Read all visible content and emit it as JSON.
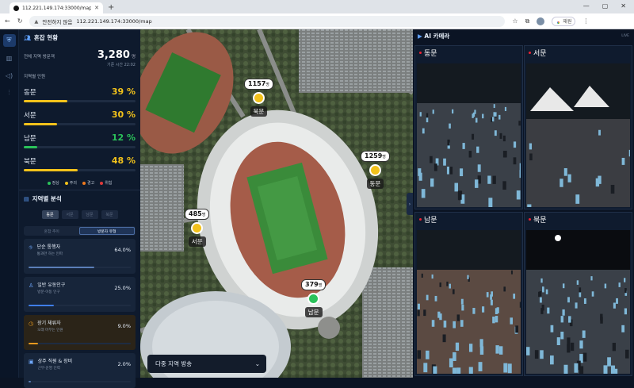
{
  "browser": {
    "tab_title": "112.221.149.174:33000/map",
    "security_label": "안전하지 않음",
    "url": "112.221.149.174:33000/map",
    "relaunch_label": "재원"
  },
  "rail": {
    "items": [
      "shield",
      "map",
      "speaker",
      "sliders"
    ]
  },
  "summary": {
    "title": "혼잡 현황",
    "total_label": "전체 지역 방문객",
    "total_value": "3,280",
    "total_unit": "명",
    "time_label": "기준 시간 22:02",
    "zones_label": "지역별 인원"
  },
  "zones": [
    {
      "name": "동문",
      "percent_text": "39 %",
      "percent": 39,
      "color": "#f2c21b"
    },
    {
      "name": "서문",
      "percent_text": "30 %",
      "percent": 30,
      "color": "#f2c21b"
    },
    {
      "name": "남문",
      "percent_text": "12 %",
      "percent": 12,
      "color": "#2bc25a"
    },
    {
      "name": "북문",
      "percent_text": "48 %",
      "percent": 48,
      "color": "#f2c21b"
    }
  ],
  "legend": [
    {
      "label": "정상",
      "color": "#2bc25a"
    },
    {
      "label": "주의",
      "color": "#f2c21b"
    },
    {
      "label": "경고",
      "color": "#f07a1d"
    },
    {
      "label": "위험",
      "color": "#e03a3a"
    }
  ],
  "analysis": {
    "title": "지역별 분석",
    "tabs": [
      "동문",
      "서문",
      "남문",
      "북문"
    ],
    "seg": [
      "혼잡 추이",
      "방문자 유형"
    ],
    "cards": [
      {
        "title": "단순 통행자",
        "desc": "통과만 하는 인파",
        "value": "64.0%",
        "fill": 64,
        "color": "#5b7fb8",
        "icon": "walker-icon",
        "glyph": "⛗"
      },
      {
        "title": "일반 유동인구",
        "desc": "방문·이동 인구",
        "value": "25.0%",
        "fill": 25,
        "color": "#3f7ee8",
        "icon": "person-icon",
        "glyph": "♙"
      },
      {
        "title": "장기 체류자",
        "desc": "오래 머무는 인원",
        "value": "9.0%",
        "fill": 9,
        "color": "#e89a1f",
        "icon": "clock-icon",
        "glyph": "◷"
      },
      {
        "title": "상주 직원 & 장비",
        "desc": "근무·운영 인력",
        "value": "2.0%",
        "fill": 2,
        "color": "#5b7fb8",
        "icon": "briefcase-icon",
        "glyph": "▣"
      }
    ]
  },
  "map": {
    "broadcast_label": "다중 지역 방송",
    "markers": [
      {
        "id": "north",
        "count": "1157",
        "unit": "명",
        "label": "북문",
        "color": "#f2c21b"
      },
      {
        "id": "east",
        "count": "1259",
        "unit": "명",
        "label": "동문",
        "color": "#f2c21b"
      },
      {
        "id": "west",
        "count": "485",
        "unit": "명",
        "label": "서문",
        "color": "#f2c21b"
      },
      {
        "id": "south",
        "count": "379",
        "unit": "명",
        "label": "남문",
        "color": "#2bc25a"
      }
    ]
  },
  "cameras": {
    "title": "AI 카메라",
    "live_label": "LIVE",
    "feeds": [
      "동문",
      "서문",
      "남문",
      "북문"
    ]
  }
}
